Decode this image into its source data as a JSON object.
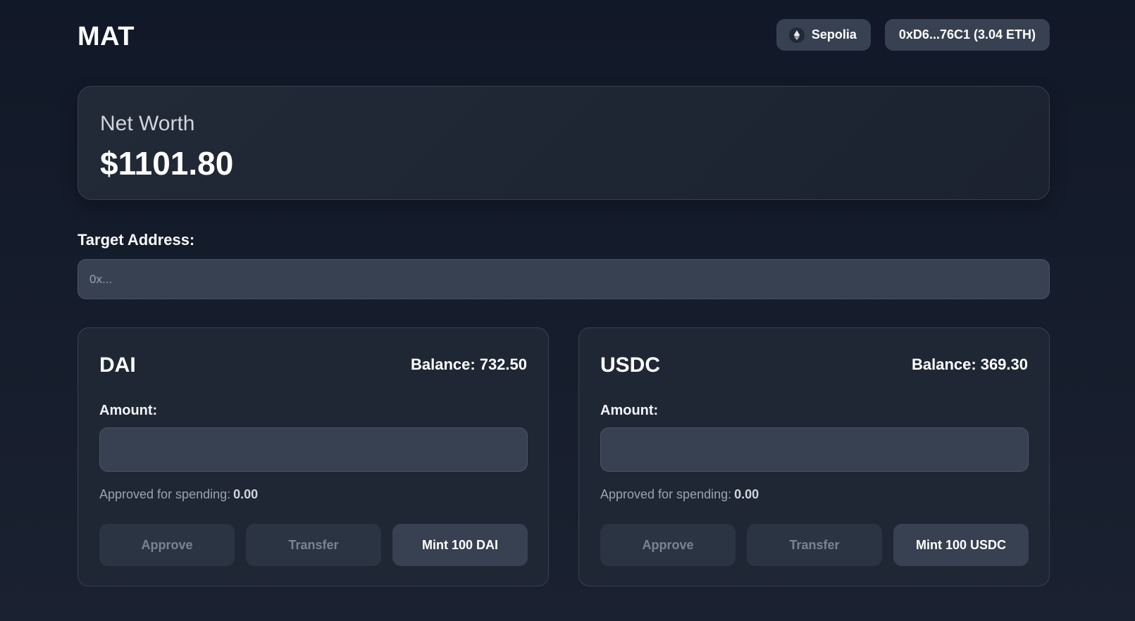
{
  "header": {
    "logo": "MAT",
    "network": {
      "label": "Sepolia",
      "icon": "ethereum-icon"
    },
    "account": {
      "label": "0xD6...76C1 (3.04 ETH)"
    }
  },
  "networth": {
    "label": "Net Worth",
    "value": "$1101.80"
  },
  "target": {
    "label": "Target Address:",
    "placeholder": "0x..."
  },
  "tokens": [
    {
      "name": "DAI",
      "balance_label": "Balance:",
      "balance": "732.50",
      "amount_label": "Amount:",
      "amount_value": "",
      "approved_label": "Approved for spending:",
      "approved_value": "0.00",
      "approve_button": "Approve",
      "transfer_button": "Transfer",
      "mint_button": "Mint 100 DAI"
    },
    {
      "name": "USDC",
      "balance_label": "Balance:",
      "balance": "369.30",
      "amount_label": "Amount:",
      "amount_value": "",
      "approved_label": "Approved for spending:",
      "approved_value": "0.00",
      "approve_button": "Approve",
      "transfer_button": "Transfer",
      "mint_button": "Mint 100 USDC"
    }
  ],
  "colors": {
    "background": "#111827",
    "card": "#1f2735",
    "input": "#374151",
    "button_disabled": "#2b3442",
    "button_primary": "#374151",
    "text_muted": "#9ca3af"
  }
}
